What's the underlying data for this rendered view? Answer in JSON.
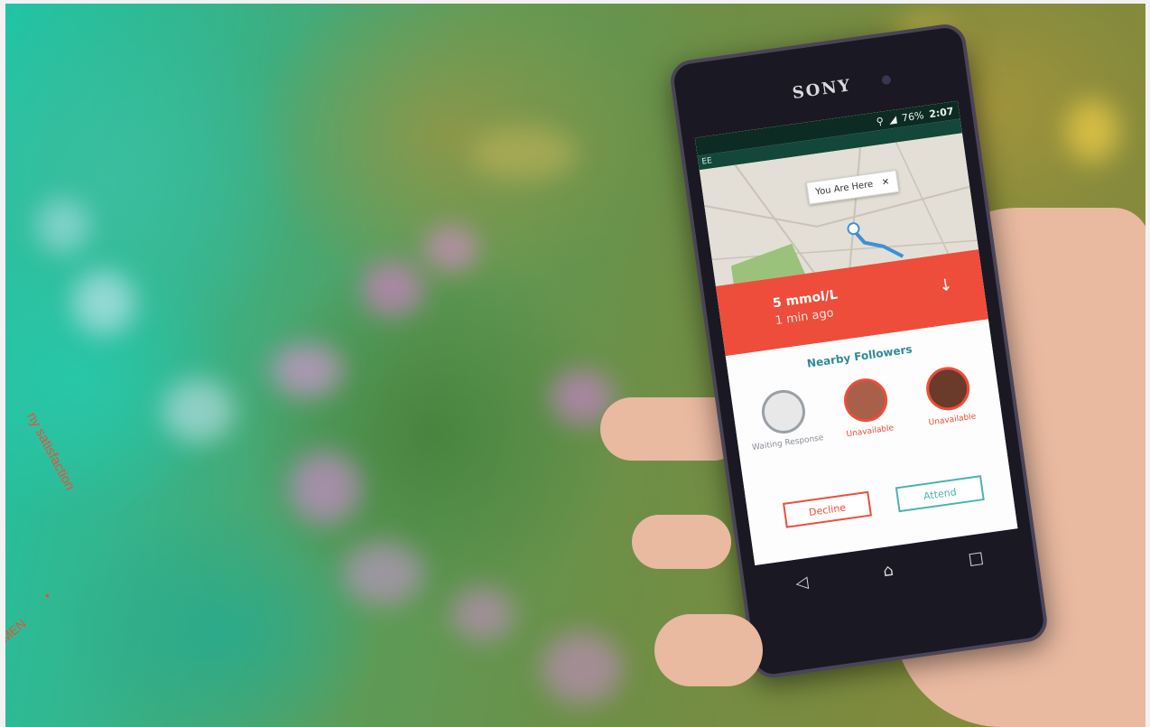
{
  "photo": {
    "device_brand": "SONY",
    "status_bar": {
      "battery": "76%",
      "time": "2:07"
    },
    "app_bar": {
      "carrier": "EE"
    },
    "map": {
      "pin_label": "You Are Here",
      "pin_close": "✕"
    },
    "alert": {
      "reading": "5 mmol/L",
      "time_ago": "1 min ago",
      "arrow": "↓"
    },
    "followers": {
      "title": "Nearby Followers",
      "people": [
        {
          "status": "Waiting Response",
          "color": "#9aa0a6"
        },
        {
          "status": "Unavailable",
          "color": "#ed4d3a"
        },
        {
          "status": "Unavailable",
          "color": "#ed4d3a"
        }
      ]
    },
    "buttons": {
      "decline": "Decline",
      "attend": "Attend"
    },
    "nav": {
      "back": "◁",
      "home": "⌂",
      "recent": "□"
    },
    "stamp_text": [
      "ny satisfaction",
      "•",
      "MEN"
    ],
    "colors": {
      "alert_red": "#ed4d3a",
      "attend_teal": "#4bb2b0",
      "app_green": "#13473a"
    }
  }
}
